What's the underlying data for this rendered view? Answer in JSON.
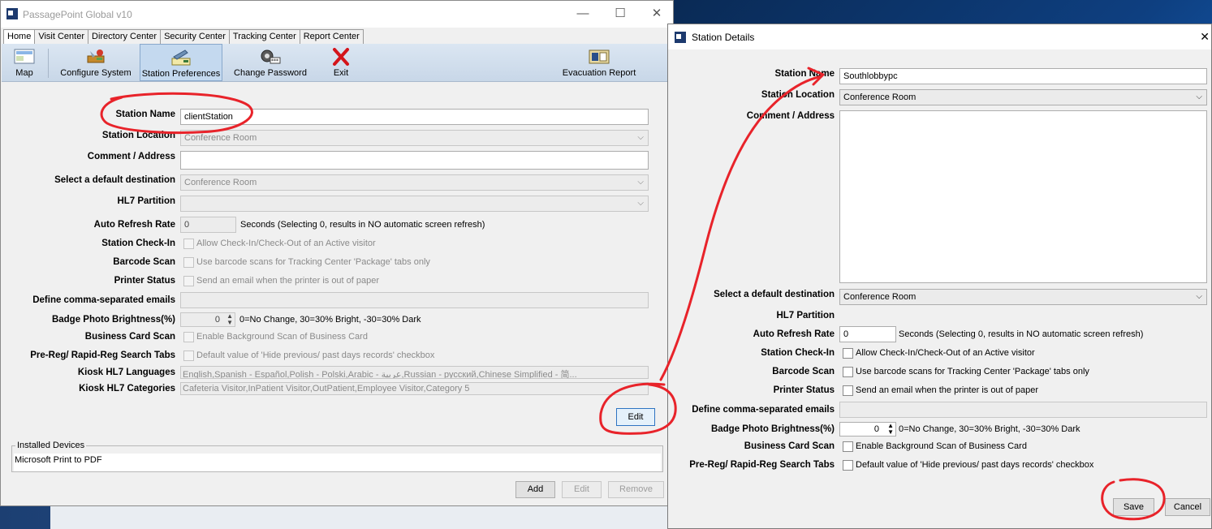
{
  "window": {
    "title": "PassagePoint Global v10",
    "controls": {
      "minimize": "—",
      "maximize": "☐",
      "close": "✕"
    }
  },
  "tabs": [
    "Home",
    "Visit Center",
    "Directory Center",
    "Security Center",
    "Tracking Center",
    "Report Center"
  ],
  "toolbar": {
    "map": "Map",
    "configure": "Configure System",
    "prefs": "Station Preferences",
    "password": "Change Password",
    "exit": "Exit",
    "evac": "Evacuation Report"
  },
  "main": {
    "labels": {
      "station_name": "Station Name",
      "station_location": "Station Location",
      "comment": "Comment / Address",
      "default_dest": "Select a default destination",
      "hl7_partition": "HL7 Partition",
      "auto_refresh": "Auto Refresh Rate",
      "checkin": "Station Check-In",
      "barcode": "Barcode Scan",
      "printer": "Printer Status",
      "emails": "Define comma-separated emails",
      "brightness": "Badge Photo Brightness(%)",
      "business_card": "Business Card Scan",
      "prereg": "Pre-Reg/ Rapid-Reg Search Tabs",
      "kiosk_lang": "Kiosk HL7 Languages",
      "kiosk_cat": "Kiosk HL7 Categories"
    },
    "values": {
      "station_name": "clientStation",
      "station_location": "Conference Room",
      "comment": "",
      "default_dest": "Conference Room",
      "hl7_partition": "",
      "auto_refresh": "0",
      "refresh_note": "Seconds (Selecting 0, results in NO automatic screen refresh)",
      "checkin_text": "Allow Check-In/Check-Out of an Active visitor",
      "barcode_text": "Use barcode scans for Tracking Center 'Package' tabs only",
      "printer_text": "Send an email when the printer is out of paper",
      "emails": "",
      "brightness": "0",
      "brightness_note": "0=No Change, 30=30% Bright, -30=30% Dark",
      "business_text": "Enable Background Scan of Business Card",
      "prereg_text": "Default value of 'Hide previous/ past days records' checkbox",
      "kiosk_lang": "English,Spanish - Español,Polish - Polski,Arabic - عربية,Russian - русский,Chinese Simplified - 简...",
      "kiosk_cat": "Cafeteria Visitor,InPatient Visitor,OutPatient,Employee Visitor,Category 5"
    },
    "edit_button": "Edit",
    "installed_caption": "Installed Devices",
    "installed_items": [
      "Microsoft Print to PDF"
    ],
    "device_buttons": {
      "add": "Add",
      "edit": "Edit",
      "remove": "Remove"
    }
  },
  "dialog": {
    "title": "Station Details",
    "close": "✕",
    "labels": {
      "station_name": "Station Name",
      "station_location": "Station Location",
      "comment": "Comment / Address",
      "default_dest": "Select a default destination",
      "hl7_partition": "HL7 Partition",
      "auto_refresh": "Auto Refresh Rate",
      "checkin": "Station Check-In",
      "barcode": "Barcode Scan",
      "printer": "Printer Status",
      "emails": "Define comma-separated emails",
      "brightness": "Badge Photo Brightness(%)",
      "business_card": "Business Card Scan",
      "prereg": "Pre-Reg/ Rapid-Reg Search Tabs"
    },
    "values": {
      "station_name": "Southlobbypc",
      "station_location": "Conference Room",
      "default_dest": "Conference Room",
      "auto_refresh": "0",
      "refresh_note": "Seconds (Selecting 0, results in NO automatic screen refresh)",
      "checkin_text": "Allow Check-In/Check-Out of an Active visitor",
      "barcode_text": "Use barcode scans for Tracking Center 'Package' tabs only",
      "printer_text": "Send an email when the printer is out of paper",
      "brightness": "0",
      "brightness_note": "0=No Change, 30=30% Bright, -30=30% Dark",
      "business_text": "Enable Background Scan of Business Card",
      "prereg_text": "Default value of 'Hide previous/ past days records' checkbox"
    },
    "save": "Save",
    "cancel": "Cancel"
  },
  "colors": {
    "annotation": "#e8232a",
    "accent": "#2f74c2"
  }
}
